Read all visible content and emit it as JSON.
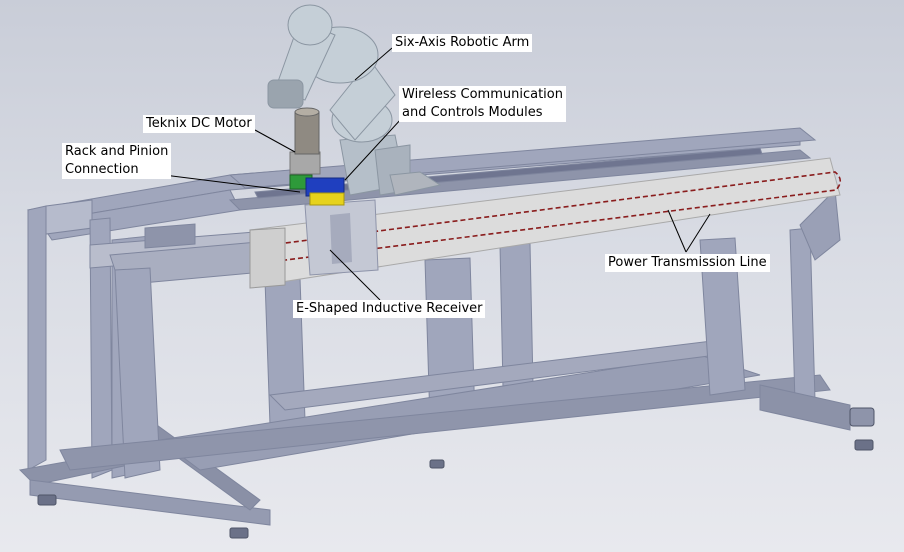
{
  "labels": {
    "robotic_arm": "Six-Axis Robotic Arm",
    "wireless_line1": "Wireless Communication",
    "wireless_line2": "and Controls Modules",
    "dc_motor": "Teknix DC Motor",
    "rack_line1": "Rack and Pinion",
    "rack_line2": "Connection",
    "power_line": "Power Transmission Line",
    "receiver": "E-Shaped Inductive Receiver"
  },
  "colors": {
    "frame": "#9ea4bb",
    "frame_dark": "#7f869e",
    "frame_light": "#c3c7d6",
    "robot": "#c5cfd7",
    "panel": "#dcdcdc",
    "power_line": "#8a1d1d",
    "module_blue": "#1f3fbf",
    "module_yellow": "#e6d21c",
    "module_green": "#2e9a3a"
  }
}
